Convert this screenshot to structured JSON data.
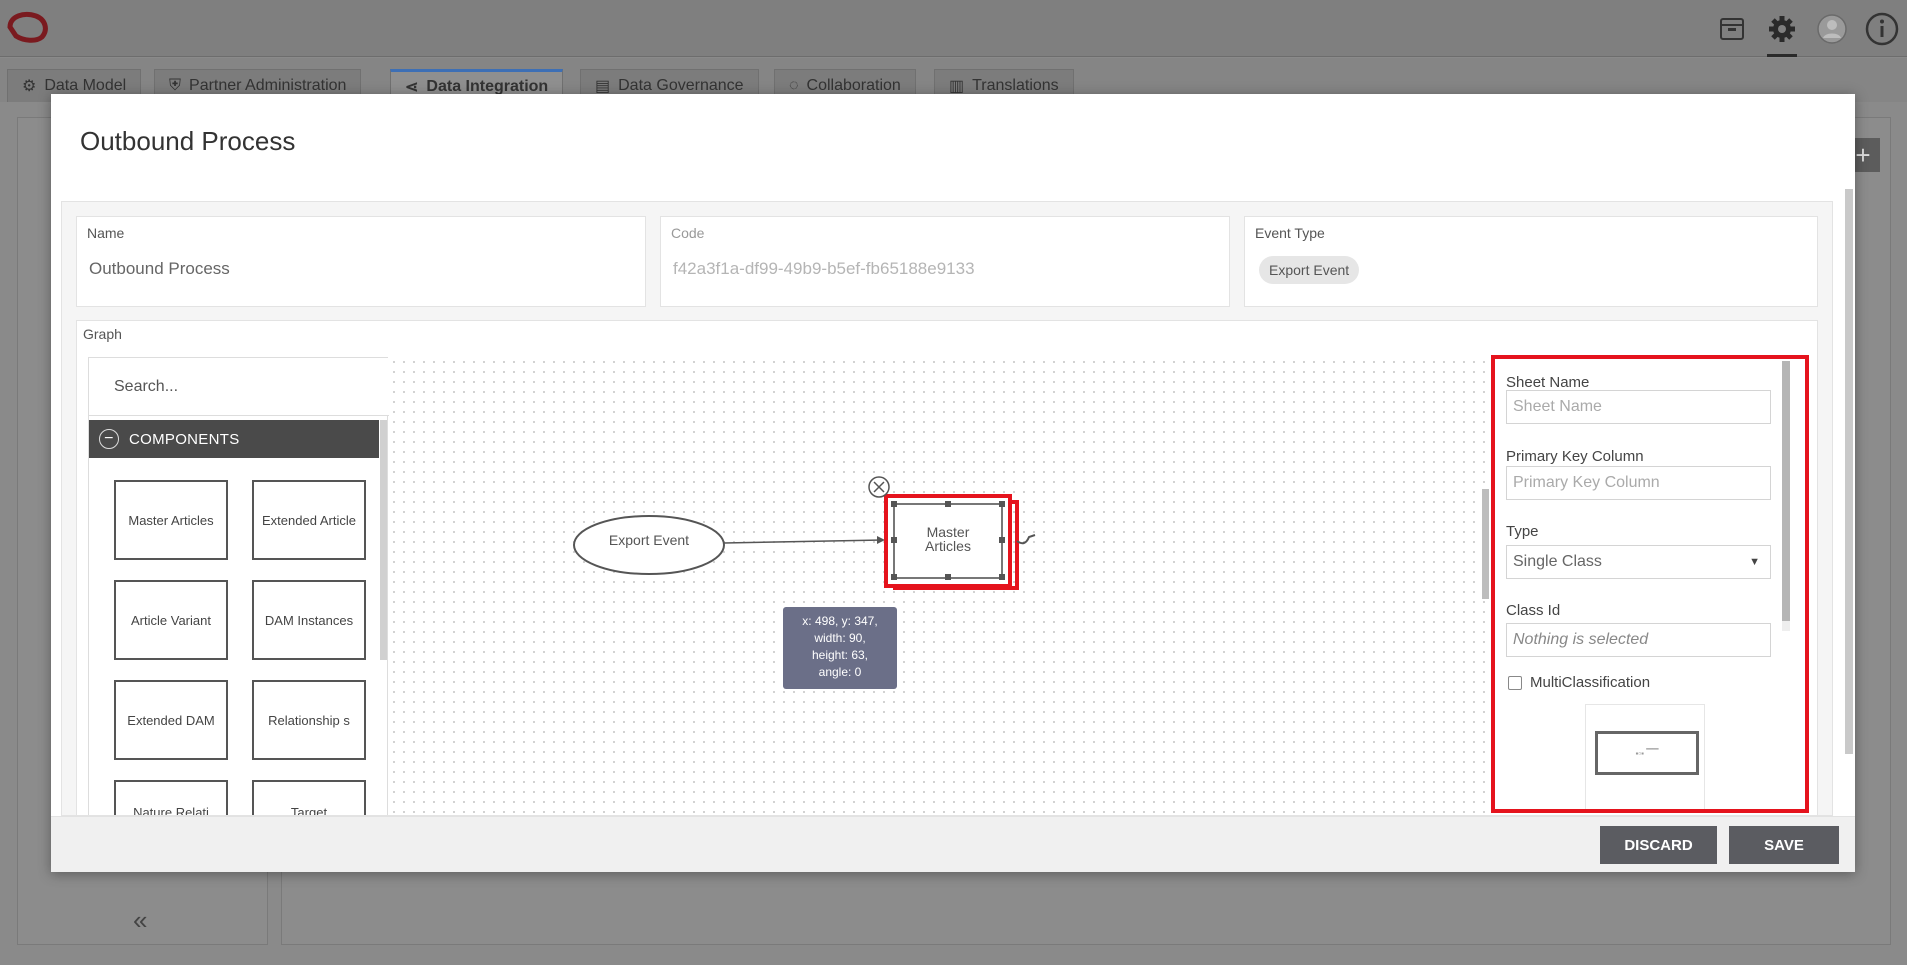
{
  "nav": {
    "tabs": [
      {
        "label": "Data Model"
      },
      {
        "label": "Partner Administration"
      },
      {
        "label": "Data Integration"
      },
      {
        "label": "Data Governance"
      },
      {
        "label": "Collaboration"
      },
      {
        "label": "Translations"
      }
    ]
  },
  "modal": {
    "title": "Outbound Process",
    "name_label": "Name",
    "name_value": "Outbound Process",
    "code_label": "Code",
    "code_value": "f42a3f1a-df99-49b9-b5ef-fb65188e9133",
    "event_type_label": "Event Type",
    "event_type_value": "Export Event",
    "graph_label": "Graph"
  },
  "stencil": {
    "search_placeholder": "Search...",
    "group_label": "COMPONENTS",
    "components": [
      "Master Articles",
      "Extended Article",
      "Article Variant",
      "DAM Instances",
      "Extended DAM",
      "Relationship s",
      "Nature Relati",
      "Target"
    ]
  },
  "graph": {
    "export_node": "Export Event",
    "selected_node": "Master Articles",
    "tooltip_lines": [
      "x: 498, y: 347,",
      "width: 90,",
      "height: 63,",
      "angle: 0"
    ]
  },
  "inspector": {
    "sheet_name_label": "Sheet Name",
    "sheet_name_placeholder": "Sheet Name",
    "primary_key_label": "Primary Key Column",
    "primary_key_placeholder": "Primary Key Column",
    "type_label": "Type",
    "type_value": "Single Class",
    "class_id_label": "Class Id",
    "class_id_value": "Nothing is selected",
    "multi_label": "MultiClassification",
    "multi_checked": false
  },
  "footer": {
    "discard_label": "DISCARD",
    "save_label": "SAVE"
  },
  "colors": {
    "highlight": "#e5131d",
    "tab_accent": "#3d6fb5",
    "button": "#5b5c61",
    "tooltip": "#6b6f88"
  },
  "icons": [
    "logo-icon",
    "archive-icon",
    "gear-icon",
    "user-avatar-icon",
    "info-icon",
    "double-chevron-left-icon",
    "minus-circle-icon",
    "close-icon",
    "chevron-down-icon"
  ]
}
